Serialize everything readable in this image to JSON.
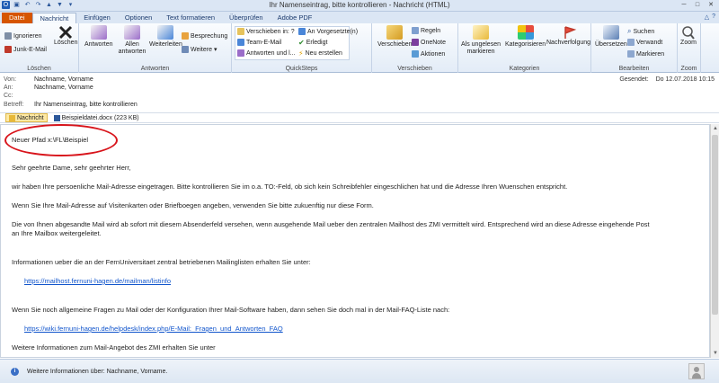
{
  "window": {
    "title": "Ihr Namenseintrag, bitte kontrollieren - Nachricht (HTML)"
  },
  "ribbon_tabs": [
    "Datei",
    "Nachricht",
    "Einfügen",
    "Optionen",
    "Text formatieren",
    "Überprüfen",
    "Adobe PDF"
  ],
  "groups": {
    "loeschen": {
      "label": "Löschen",
      "ignorieren": "Ignorieren",
      "junk": "Junk-E-Mail",
      "loeschen": "Löschen"
    },
    "antworten": {
      "label": "Antworten",
      "antworten": "Antworten",
      "allen": "Allen antworten",
      "weiterleiten": "Weiterleiten",
      "besprechung": "Besprechung",
      "weitere": "Weitere"
    },
    "quicksteps": {
      "label": "QuickSteps",
      "items": [
        "Verschieben in: ?",
        "Team-E-Mail",
        "Antworten und l...",
        "An Vorgesetzte(n)",
        "Erledigt",
        "Neu erstellen"
      ]
    },
    "verschieben": {
      "label": "Verschieben",
      "verschieben": "Verschieben",
      "regeln": "Regeln",
      "onenote": "OneNote",
      "aktionen": "Aktionen"
    },
    "kategorien": {
      "label": "Kategorien",
      "ungelesen": "Als ungelesen markieren",
      "kategorisieren": "Kategorisieren",
      "nachverfolgung": "Nachverfolgung"
    },
    "bearbeiten": {
      "label": "Bearbeiten",
      "uebersetzen": "Übersetzen",
      "suchen": "Suchen",
      "verwandt": "Verwandt",
      "markieren": "Markieren"
    },
    "zoom": {
      "label": "Zoom",
      "zoom": "Zoom"
    }
  },
  "header": {
    "von_label": "Von:",
    "von": "Nachname, Vorname",
    "an_label": "An:",
    "an": "Nachname, Vorname",
    "cc_label": "Cc:",
    "cc": "",
    "betreff_label": "Betreff:",
    "betreff": "Ihr Namenseintrag, bitte kontrollieren",
    "gesendet_label": "Gesendet:",
    "gesendet": "Do 12.07.2018 10:15"
  },
  "attachments": [
    {
      "name": "Nachricht"
    },
    {
      "name": "Beispieldatei.docx (223 KB)"
    }
  ],
  "body": {
    "pfad": "Neuer Pfad x:\\FL\\Beispiel",
    "anrede": "Sehr geehrte Dame, sehr geehrter Herr,",
    "p1": "wir haben Ihre persoenliche Mail-Adresse eingetragen. Bitte kontrollieren Sie im o.a. TO:-Feld, ob sich kein Schreibfehler eingeschlichen hat und die Adresse Ihren Wuenschen entspricht.",
    "p2": "Wenn Sie Ihre Mail-Adresse auf Visitenkarten oder Briefboegen angeben, verwenden Sie bitte zukuenftig nur diese Form.",
    "p3a": "Die von Ihnen abgesandte Mail wird ab sofort mit diesem Absenderfeld versehen, wenn ausgehende Mail ueber den zentralen Mailhost des ZMI vermittelt wird. Entsprechend wird an diese Adresse eingehende Post",
    "p3b": "an Ihre Mailbox weitergeleitet.",
    "p4": "Informationen ueber die an der FernUniversitaet zentral betriebenen Mailinglisten erhalten Sie unter:",
    "link1": "https://mailhost.fernuni-hagen.de/mailman/listinfo",
    "p5": "Wenn Sie noch allgemeine Fragen zu Mail oder der Konfiguration Ihrer Mail-Software haben, dann sehen Sie doch mal in der Mail-FAQ-Liste nach:",
    "link2": "https://wiki.fernuni-hagen.de/helpdesk/index.php/E-Mail:_Fragen_und_Antworten_FAQ",
    "p6": "Weitere Informationen zum Mail-Angebot des ZMI erhalten Sie unter"
  },
  "status": {
    "text": "Weitere Informationen über: Nachname, Vorname."
  },
  "colors": {
    "file_tab": "#d65500",
    "link": "#1155cc",
    "annotation": "#d8141b"
  }
}
